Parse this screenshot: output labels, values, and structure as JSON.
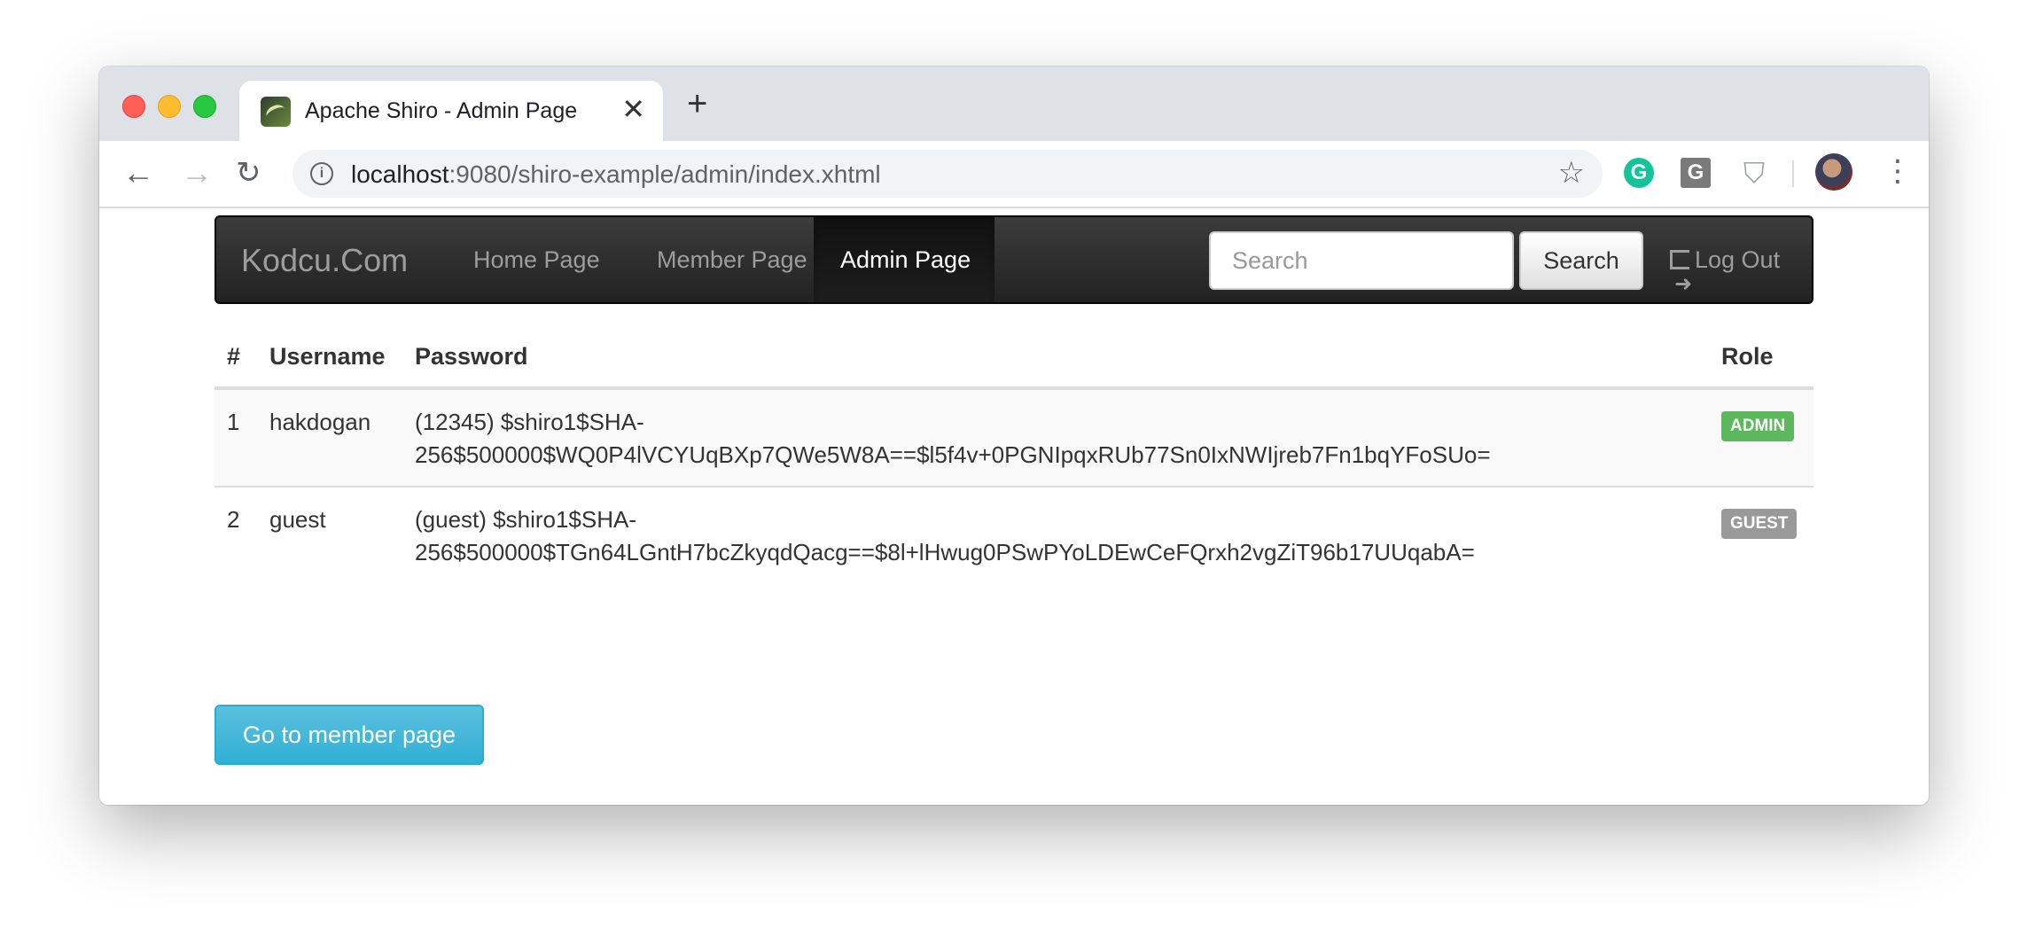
{
  "browser": {
    "tab_title": "Apache Shiro - Admin Page",
    "tab_close": "✕",
    "new_tab": "+",
    "url_host": "localhost",
    "url_path": ":9080/shiro-example/admin/index.xhtml",
    "extensions": [
      "grammarly-icon",
      "g-extension-icon",
      "shield-extension-icon"
    ],
    "grammarly_letter": "G",
    "g_letter": "G"
  },
  "navbar": {
    "brand": "Kodcu.Com",
    "items": [
      {
        "label": "Home Page",
        "active": false
      },
      {
        "label": "Member Page",
        "active": false
      },
      {
        "label": "Admin Page",
        "active": true
      }
    ],
    "search_placeholder": "Search",
    "search_button": "Search",
    "logout": "Log Out"
  },
  "table": {
    "headers": [
      "#",
      "Username",
      "Password",
      "Role"
    ],
    "rows": [
      {
        "num": "1",
        "username": "hakdogan",
        "password": "(12345) $shiro1$SHA-256$500000$WQ0P4lVCYUqBXp7QWe5W8A==$l5f4v+0PGNIpqxRUb77Sn0IxNWIjreb7Fn1bqYFoSUo=",
        "password_line1": "(12345) $shiro1$SHA-",
        "password_line2": "256$500000$WQ0P4lVCYUqBXp7QWe5W8A==$l5f4v+0PGNIpqxRUb77Sn0IxNWIjreb7Fn1bqYFoSUo=",
        "role": "ADMIN"
      },
      {
        "num": "2",
        "username": "guest",
        "password": "(guest) $shiro1$SHA-256$500000$TGn64LGntH7bcZkyqdQacg==$8l+lHwug0PSwPYoLDEwCeFQrxh2vgZiT96b17UUqabA=",
        "password_line1": "(guest) $shiro1$SHA-",
        "password_line2": "256$500000$TGn64LGntH7bcZkyqdQacg==$8l+lHwug0PSwPYoLDEwCeFQrxh2vgZiT96b17UUqabA=",
        "role": "GUEST"
      }
    ]
  },
  "member_button": "Go to member page",
  "colors": {
    "admin_badge": "#5cb85c",
    "guest_badge": "#999999",
    "info_button": "#5bc0de",
    "navbar": "#222222"
  }
}
